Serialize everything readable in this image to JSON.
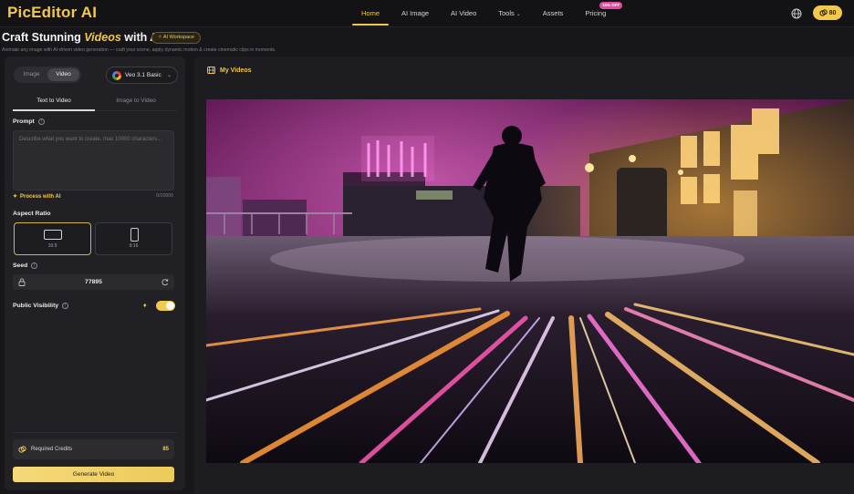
{
  "app": {
    "title": "PicEditor AI"
  },
  "nav": {
    "items": [
      {
        "label": "Home"
      },
      {
        "label": "AI Image"
      },
      {
        "label": "AI Video"
      },
      {
        "label": "Tools"
      },
      {
        "label": "Assets"
      },
      {
        "label": "Pricing",
        "badge": "15% OFF"
      }
    ],
    "active": "Home"
  },
  "header": {
    "credits": "80",
    "title_before": "Craft Stunning ",
    "title_em": "Videos",
    "title_after": " with AI",
    "workspace_badge": "AI Workspace",
    "subtitle": "Animate any image with AI-driven video generation — craft your scene, apply dynamic motion & create cinematic clips in moments."
  },
  "panel": {
    "mode_options": [
      "Image",
      "Video"
    ],
    "mode_selected": "Video",
    "model": "Veo 3.1 Basic",
    "tabs": [
      "Text to Video",
      "Image to Video"
    ],
    "tab_selected": "Text to Video",
    "prompt_label": "Prompt",
    "prompt_placeholder": "Describe what you want to create, max 10000 characters...",
    "process_ai": "Process with AI",
    "char_count": "0/10000",
    "aspect_label": "Aspect Ratio",
    "aspect_options": [
      {
        "label": "16:9",
        "selected": true
      },
      {
        "label": "9:16",
        "selected": false
      }
    ],
    "seed_label": "Seed",
    "seed_value": "77895",
    "visibility_label": "Public Visibility",
    "visibility_on": true,
    "credits_label": "Required Credits",
    "credits_value": "85",
    "generate_label": "Generate Video"
  },
  "right": {
    "title": "My Videos"
  },
  "colors": {
    "accent": "#f2c94c",
    "bg": "#17171b",
    "panel": "#212125",
    "pink_badge": "#e64aa0"
  }
}
